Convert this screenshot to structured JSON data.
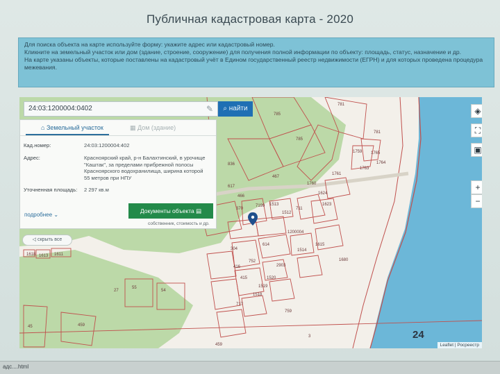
{
  "page_title": "Публичная кадастровая карта - 2020",
  "info_lines": [
    "Для поиска объекта на карте используйте форму: укажите адрес или кадастровый номер.",
    "Кликните на земельный участок или дом (здание, строение, сооружение) для получения полной информации по объекту: площадь, статус, назначение и др.",
    "На карте указаны объекты, которые поставлены на кадастровый учёт в Едином государственный реестр недвижимости (ЕГРН) и для которых проведена процедура межевания."
  ],
  "search": {
    "value": "24:03:1200004:0402",
    "button": "найти"
  },
  "card": {
    "tab_land": "Земельный участок",
    "tab_house": "Дом (здание)",
    "rows": [
      {
        "label": "Кад.номер:",
        "value": "24:03:1200004:402"
      },
      {
        "label": "Адрес:",
        "value": "Красноярский край, р-н Балахтинский, в урочище \"Каштак\", за пределами прибрежной полосы Красноярского водохранилища, ширина которой 55 метров при НПУ"
      },
      {
        "label": "Уточненная площадь:",
        "value": "2 297 кв.м"
      }
    ],
    "more": "подробнее",
    "docs_button": "Документы объекта",
    "docs_sub": "собственник, стоимость и др."
  },
  "hide_all": "скрыть все",
  "map_labels": [
    "781",
    "785",
    "781",
    "785",
    "1759",
    "1765",
    "1763",
    "1764",
    "836",
    "467",
    "1760",
    "1761",
    "1624",
    "1623",
    "617",
    "466",
    "711",
    "1513",
    "1512",
    "7199",
    "370",
    "1200004",
    "1514",
    "1615",
    "1618",
    "1613",
    "1611",
    "304",
    "752",
    "614",
    "416",
    "415",
    "1680",
    "2903",
    "1520",
    "1519",
    "1518",
    "717",
    "759",
    "55",
    "54",
    "27",
    "45",
    "459",
    "459",
    "3"
  ],
  "map_number": "24",
  "attribution": "Leaflet | Росреестр",
  "taskbar_file": "адс....html",
  "colors": {
    "accent": "#1f6fb4",
    "docs_green": "#238a4a",
    "water": "#6cb7d8",
    "forest": "#bcd9a8",
    "parcel": "#c0504d"
  },
  "icons": [
    "search-icon",
    "clear-icon",
    "building-icon",
    "house-icon",
    "document-icon",
    "chevron-down-icon",
    "eye-icon",
    "layers-icon",
    "fullscreen-icon",
    "square-icon",
    "plus-icon",
    "minus-icon",
    "map-pin-icon"
  ]
}
